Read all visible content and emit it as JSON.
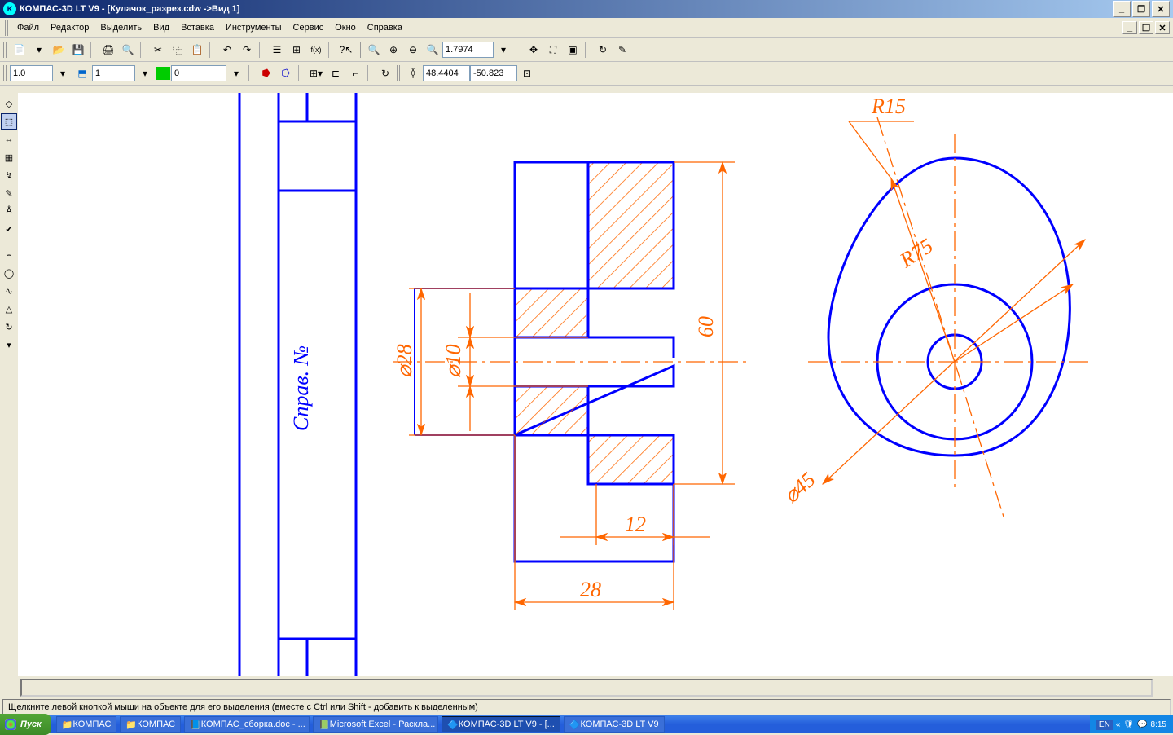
{
  "titlebar": {
    "app": "КОМПАС-3D LT V9 - [Кулачок_разрез.cdw ->Вид 1]"
  },
  "menu": {
    "file": "Файл",
    "edit": "Редактор",
    "select": "Выделить",
    "view": "Вид",
    "insert": "Вставка",
    "tools": "Инструменты",
    "service": "Сервис",
    "window": "Окно",
    "help": "Справка"
  },
  "toolbar1": {
    "zoom": "1.7974"
  },
  "toolbar2": {
    "scale": "1.0",
    "layer": "1",
    "style": "0",
    "coordX": "48.4404",
    "coordY": "-50.823"
  },
  "drawing": {
    "annot": "Справ. №",
    "d28": "⌀28",
    "d10": "⌀10",
    "d45": "⌀45",
    "h60": "60",
    "w12": "12",
    "w28": "28",
    "r15": "R15",
    "r75": "R75"
  },
  "status": {
    "hint": "Щелкните левой кнопкой мыши на объекте для его выделения (вместе с Ctrl или Shift - добавить к выделенным)"
  },
  "taskbar": {
    "start": "Пуск",
    "items": [
      {
        "label": "КОМПАС"
      },
      {
        "label": "КОМПАС"
      },
      {
        "label": "КОМПАС_сборка.doc - ..."
      },
      {
        "label": "Microsoft Excel - Раскла..."
      },
      {
        "label": "КОМПАС-3D LT V9 - [..."
      },
      {
        "label": "КОМПАС-3D LT V9"
      }
    ],
    "lang": "EN",
    "time": "8:15"
  }
}
